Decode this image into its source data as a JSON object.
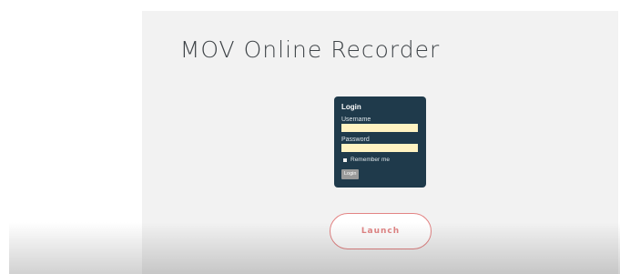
{
  "page": {
    "title": "MOV Online Recorder"
  },
  "login": {
    "heading": "Login",
    "username_label": "Username",
    "username_value": "",
    "password_label": "Password",
    "password_value": "",
    "remember_label": "Remember me",
    "remember_checked": false,
    "button_label": "Login"
  },
  "actions": {
    "launch_label": "Launch"
  },
  "colors": {
    "panel_bg": "#f2f2f2",
    "login_bg": "#1f3a4b",
    "input_bg": "#fff3c2",
    "accent": "#e38484"
  }
}
